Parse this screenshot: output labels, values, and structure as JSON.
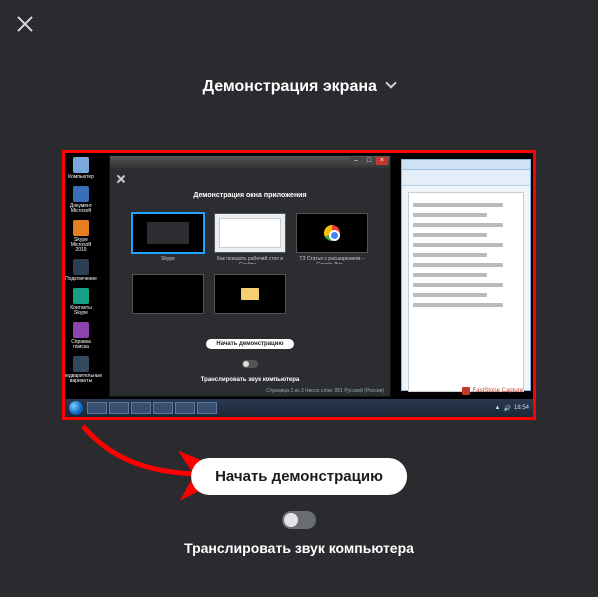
{
  "dialog": {
    "title": "Демонстрация экрана",
    "start_button": "Начать демонстрацию",
    "audio_label": "Транслировать звук компьютера",
    "audio_toggle_on": false
  },
  "inner_preview": {
    "modal_title": "Демонстрация окна приложения",
    "start_button": "Начать демонстрацию",
    "audio_label": "Транслировать звук компьютера",
    "status": "Страница 2 из 3   Число слов: 951   Русский (Россия)",
    "thumbs": [
      {
        "label": "Skype",
        "kind": "skype",
        "selected": true
      },
      {
        "label": "Как показать рабочий стол в Скайпе…",
        "kind": "doc",
        "selected": false
      },
      {
        "label": "ТЗ Статья с расширением – Google Дис…",
        "kind": "chrome",
        "selected": false
      },
      {
        "label": "",
        "kind": "blank",
        "selected": false
      },
      {
        "label": "",
        "kind": "folder",
        "selected": false
      }
    ],
    "desktop_icons": [
      "Компьютер",
      "Документ Microsoft",
      "Skype Microsoft 2019",
      "Подключение",
      "Контакты Skype",
      "Справка поиска",
      "Предварительные варианты"
    ],
    "taskbar_time": "18:54",
    "faststone": "FastStone Capture"
  }
}
